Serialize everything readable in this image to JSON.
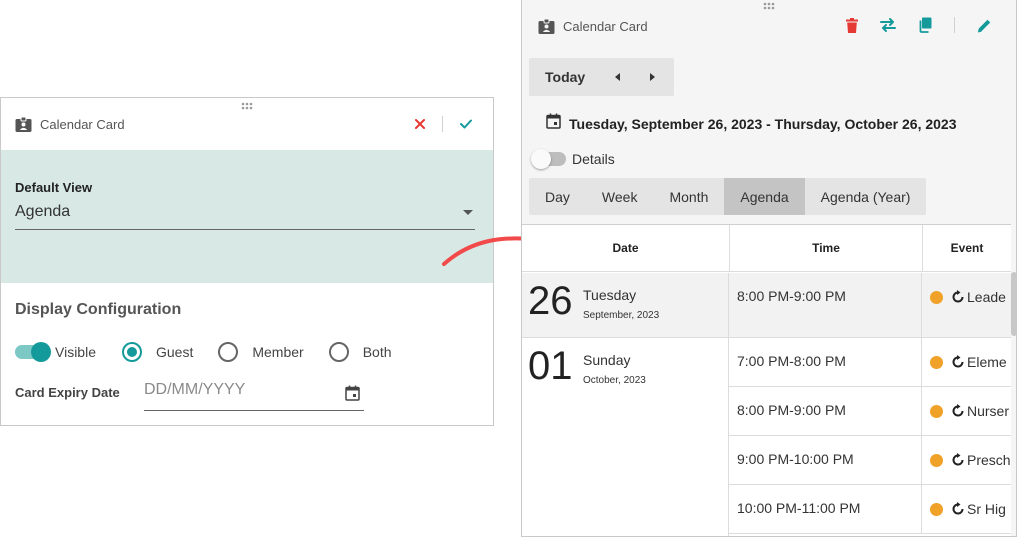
{
  "left_panel": {
    "title": "Calendar Card",
    "default_view": {
      "label": "Default View",
      "value": "Agenda"
    },
    "display_configuration": {
      "title": "Display Configuration",
      "visible_label": "Visible",
      "audience_options": [
        "Guest",
        "Member",
        "Both"
      ],
      "audience_selected": "Guest",
      "expiry_label": "Card Expiry Date",
      "expiry_placeholder": "DD/MM/YYYY"
    }
  },
  "right_panel": {
    "title": "Calendar Card",
    "nav": {
      "today_label": "Today"
    },
    "date_range": "Tuesday, September 26, 2023 - Thursday, October 26, 2023",
    "details_label": "Details",
    "view_tabs": [
      "Day",
      "Week",
      "Month",
      "Agenda",
      "Agenda (Year)"
    ],
    "active_view": "Agenda",
    "agenda": {
      "columns": [
        "Date",
        "Time",
        "Event"
      ],
      "days": [
        {
          "day_number": "26",
          "weekday": "Tuesday",
          "month_year": "September, 2023",
          "events": [
            {
              "time": "8:00 PM-9:00 PM",
              "title": "Leade"
            }
          ]
        },
        {
          "day_number": "01",
          "weekday": "Sunday",
          "month_year": "October, 2023",
          "events": [
            {
              "time": "7:00 PM-8:00 PM",
              "title": "Eleme"
            },
            {
              "time": "8:00 PM-9:00 PM",
              "title": "Nurser"
            },
            {
              "time": "9:00 PM-10:00 PM",
              "title": "Presch"
            },
            {
              "time": "10:00 PM-11:00 PM",
              "title": "Sr Hig"
            }
          ]
        }
      ]
    }
  },
  "colors": {
    "accent_teal": "#159a9b",
    "view_section_bg": "#d7e8e5",
    "delete_red": "#e53935",
    "event_dot": "#f0a127",
    "arrow_red": "#f24a4a"
  }
}
